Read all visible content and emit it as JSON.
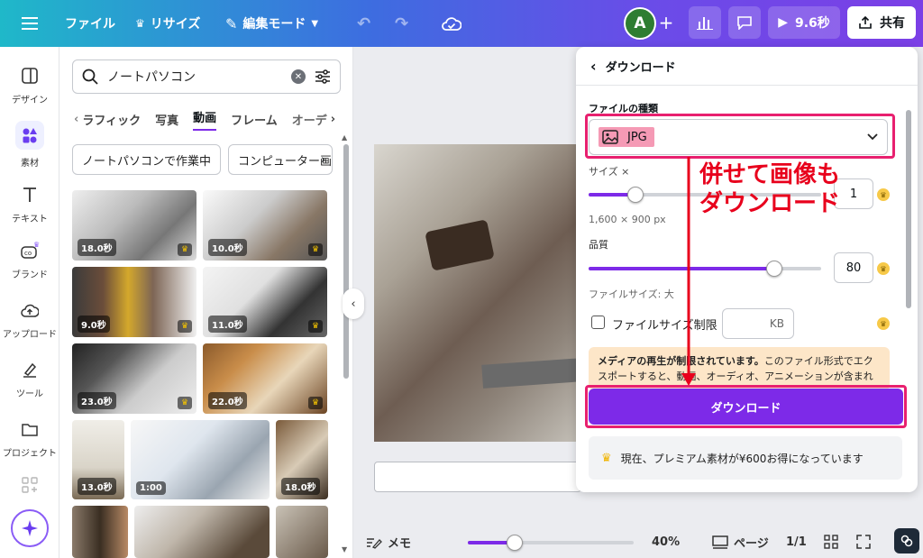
{
  "topbar": {
    "menu_icon": "hamburger-icon",
    "file_label": "ファイル",
    "resize_label": "リサイズ",
    "edit_mode_label": "編集モード",
    "avatar_letter": "A",
    "play_label": "9.6秒",
    "share_label": "共有",
    "colors": {
      "gradient_start": "#1fb8c9",
      "gradient_end": "#7b3fe6"
    }
  },
  "rail": {
    "items": [
      {
        "label": "デザイン",
        "icon": "layout-icon"
      },
      {
        "label": "素材",
        "icon": "elements-icon"
      },
      {
        "label": "テキスト",
        "icon": "text-icon"
      },
      {
        "label": "ブランド",
        "icon": "brand-icon"
      },
      {
        "label": "アップロード",
        "icon": "upload-icon"
      },
      {
        "label": "ツール",
        "icon": "draw-icon"
      },
      {
        "label": "プロジェクト",
        "icon": "folder-icon"
      }
    ]
  },
  "panel": {
    "search_value": "ノートパソコン",
    "tabs": [
      "ラフィック",
      "写真",
      "動画",
      "フレーム",
      "オーデ"
    ],
    "active_tab": "動画",
    "chips": [
      "ノートパソコンで作業中",
      "コンピューター画"
    ],
    "thumbs": [
      {
        "duration": "18.0秒"
      },
      {
        "duration": "10.0秒"
      },
      {
        "duration": "9.0秒"
      },
      {
        "duration": "11.0秒"
      },
      {
        "duration": "23.0秒"
      },
      {
        "duration": "22.0秒"
      },
      {
        "duration": "13.0秒"
      },
      {
        "duration": "1:00"
      },
      {
        "duration": "18.0秒"
      }
    ]
  },
  "download": {
    "title": "ダウンロード",
    "file_type_label": "ファイルの種類",
    "file_type_value": "JPG",
    "size_label": "サイズ ×",
    "size_value": "1",
    "size_fraction": 0.2,
    "dimensions": "1,600 × 900 px",
    "quality_label": "品質",
    "quality_value": "80",
    "quality_fraction": 0.8,
    "filesize_label": "ファイルサイズ: 大",
    "limit_label": "ファイルサイズ制限",
    "limit_unit": "KB",
    "warning_bold": "メディアの再生が制限されています。",
    "warning_text": "このファイル形式でエクスポートすると、動画、オーディオ、アニメーションが含まれ",
    "button_label": "ダウンロード",
    "promo_text": "現在、プレミアム素材が¥600お得になっています",
    "accent": "#7d2ae8"
  },
  "annotation": {
    "line1": "併せて画像も",
    "line2": "ダウンロード",
    "color": "#e8001c"
  },
  "bottombar": {
    "notes_label": "メモ",
    "zoom": "40%",
    "zoom_fraction": 0.28,
    "pages_label": "ページ",
    "page_count": "1/1"
  }
}
